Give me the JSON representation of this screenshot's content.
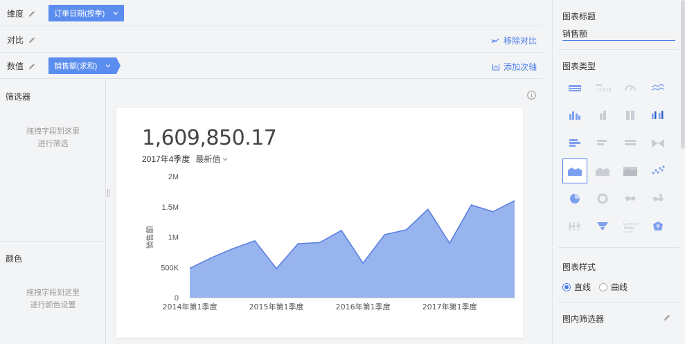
{
  "toolbar": {
    "dimension_label": "维度",
    "dimension_value": "订单日期(按季)",
    "compare_label": "对比",
    "remove_compare": "移除对比",
    "value_label": "数值",
    "value_value": "销售额(求和)",
    "add_axis": "添加次轴"
  },
  "filters": {
    "title": "筛选器",
    "hint_line1": "拖拽字段到这里",
    "hint_line2": "进行筛选"
  },
  "color": {
    "title": "颜色",
    "hint_line1": "拖拽字段到这里",
    "hint_line2": "进行颜色设置"
  },
  "card": {
    "big_number": "1,609,850.17",
    "period": "2017年4季度",
    "latest": "最新值"
  },
  "panel": {
    "chart_title_label": "图表标题",
    "chart_title_value": "销售额",
    "chart_type_label": "图表类型",
    "chart_style_label": "图表样式",
    "style_options": [
      "直线",
      "曲线"
    ],
    "style_selected": "直线",
    "inner_filter_label": "图内筛选器"
  },
  "colors": {
    "accent": "#4a7dea",
    "pill": "#5b8def",
    "area_fill": "#98b4ee",
    "area_line": "#5b7fe0"
  },
  "chart_icons": [
    "table-icon",
    "kpi-number-icon",
    "gauge-icon",
    "line-icon",
    "bar-icon",
    "stacked-bar-icon",
    "percent-bar-icon",
    "combo-bar-icon",
    "horizontal-bar-icon",
    "horizontal-stacked-icon",
    "horizontal-percent-icon",
    "butterfly-icon",
    "area-icon",
    "stacked-area-icon",
    "percent-area-icon",
    "scatter-icon",
    "pie-icon",
    "ring-icon",
    "map-icon",
    "bubble-map-icon",
    "parallel-icon",
    "funnel-icon",
    "wordcloud-icon",
    "radar-icon"
  ],
  "chart_data": {
    "type": "area",
    "ylabel": "销售额",
    "ylim": [
      0,
      2000000
    ],
    "yticks": [
      "0",
      "500K",
      "1M",
      "1.5M",
      "2M"
    ],
    "xticks": [
      "2014年第1季度",
      "2015年第1季度",
      "2016年第1季度",
      "2017年第1季度"
    ],
    "series": [
      {
        "values": [
          483000,
          660000,
          810000,
          940000,
          480000,
          890000,
          910000,
          1110000,
          570000,
          1040000,
          1120000,
          1460000,
          900000,
          1530000,
          1420000,
          1600000
        ]
      }
    ]
  }
}
